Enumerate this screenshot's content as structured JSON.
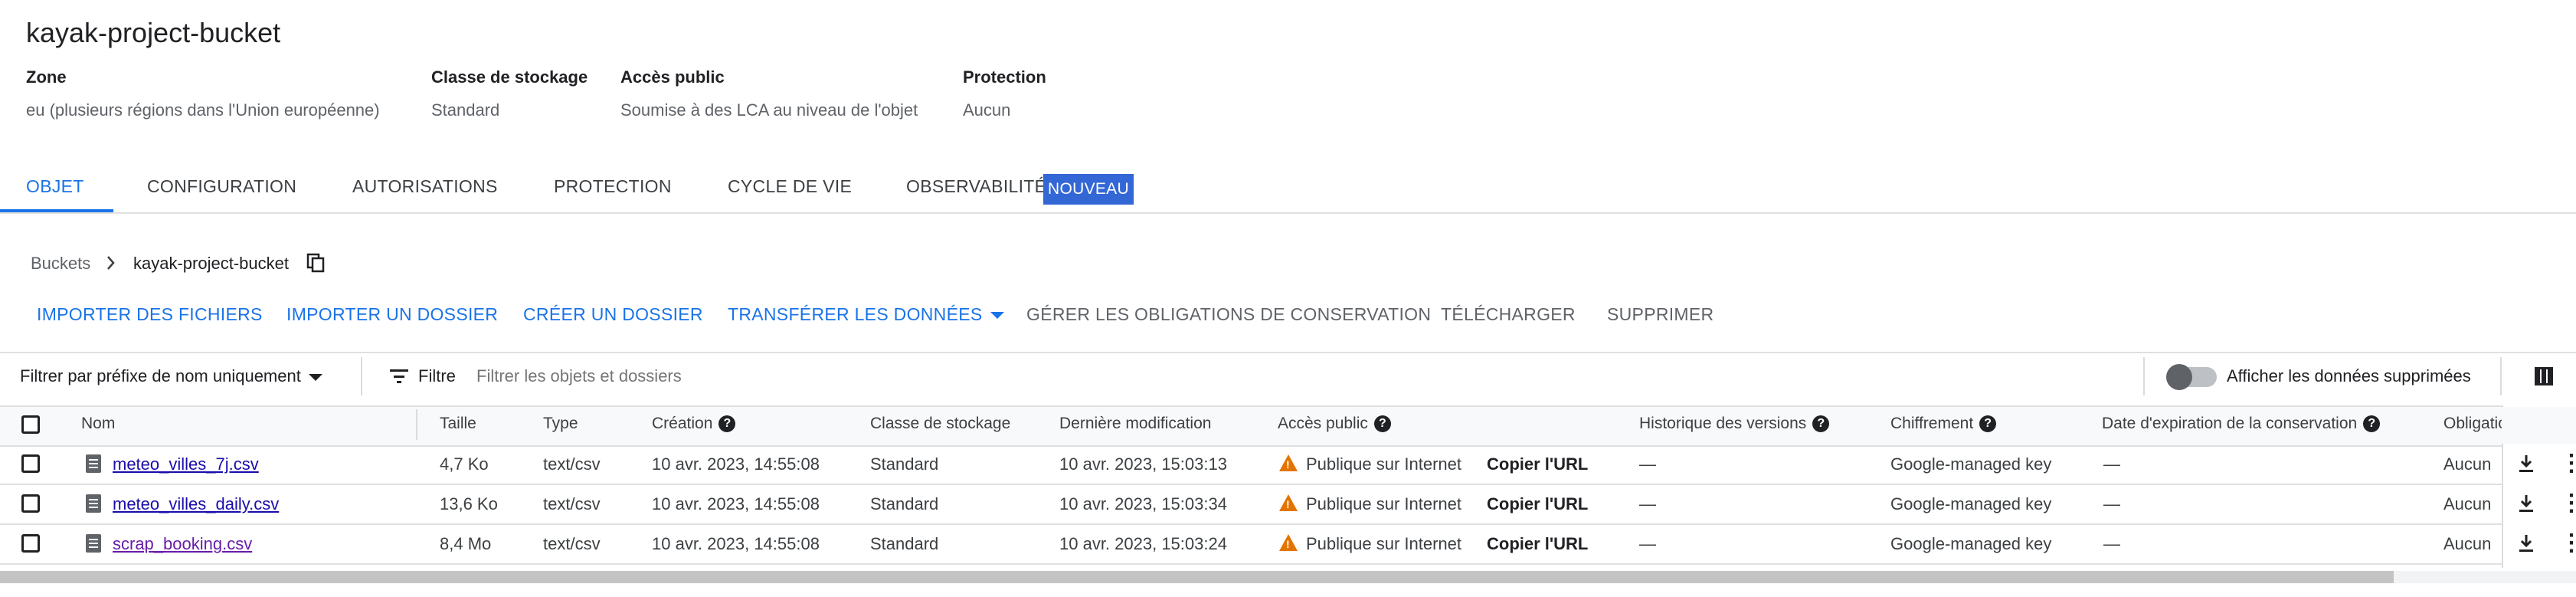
{
  "bucket": {
    "title": "kayak-project-bucket",
    "info": [
      {
        "label": "Zone",
        "value": "eu (plusieurs régions dans l'Union européenne)"
      },
      {
        "label": "Classe de stockage",
        "value": "Standard"
      },
      {
        "label": "Accès public",
        "value": "Soumise à des LCA au niveau de l'objet"
      },
      {
        "label": "Protection",
        "value": "Aucun"
      }
    ]
  },
  "tabs": [
    {
      "label": "OBJET",
      "active": true
    },
    {
      "label": "CONFIGURATION"
    },
    {
      "label": "AUTORISATIONS"
    },
    {
      "label": "PROTECTION"
    },
    {
      "label": "CYCLE DE VIE"
    },
    {
      "label": "OBSERVABILITÉ"
    }
  ],
  "tab_badge": "NOUVEAU",
  "breadcrumb": {
    "root": "Buckets",
    "current": "kayak-project-bucket"
  },
  "actions": [
    {
      "label": "IMPORTER DES FICHIERS",
      "enabled": true
    },
    {
      "label": "IMPORTER UN DOSSIER",
      "enabled": true
    },
    {
      "label": "CRÉER UN DOSSIER",
      "enabled": true
    },
    {
      "label": "TRANSFÉRER LES DONNÉES",
      "enabled": true
    },
    {
      "label": "GÉRER LES OBLIGATIONS DE CONSERVATION",
      "enabled": false
    },
    {
      "label": "TÉLÉCHARGER",
      "enabled": false
    },
    {
      "label": "SUPPRIMER",
      "enabled": false
    }
  ],
  "filter": {
    "prefix_select": "Filtrer par préfixe de nom uniquement",
    "filter_label": "Filtre",
    "placeholder": "Filtrer les objets et dossiers",
    "toggle_label": "Afficher les données supprimées",
    "toggle_on": false
  },
  "table": {
    "columns": [
      "Nom",
      "Taille",
      "Type",
      "Création",
      "Classe de stockage",
      "Dernière modification",
      "Accès public",
      "Historique des versions",
      "Chiffrement",
      "Date d'expiration de la conservation",
      "Obligatio"
    ],
    "rows": [
      {
        "name": "meteo_villes_7j.csv",
        "size": "4,7 Ko",
        "type": "text/csv",
        "created": "10 avr. 2023, 14:55:08",
        "storage": "Standard",
        "modified": "10 avr. 2023, 15:03:13",
        "access": "Publique sur Internet",
        "copy": "Copier l'URL",
        "history": "—",
        "encryption": "Google-managed key",
        "expiration": "—",
        "obligation": "Aucun"
      },
      {
        "name": "meteo_villes_daily.csv",
        "size": "13,6 Ko",
        "type": "text/csv",
        "created": "10 avr. 2023, 14:55:08",
        "storage": "Standard",
        "modified": "10 avr. 2023, 15:03:34",
        "access": "Publique sur Internet",
        "copy": "Copier l'URL",
        "history": "—",
        "encryption": "Google-managed key",
        "expiration": "—",
        "obligation": "Aucun"
      },
      {
        "name": "scrap_booking.csv",
        "size": "8,4 Mo",
        "type": "text/csv",
        "created": "10 avr. 2023, 14:55:08",
        "storage": "Standard",
        "modified": "10 avr. 2023, 15:03:24",
        "access": "Publique sur Internet",
        "copy": "Copier l'URL",
        "history": "—",
        "encryption": "Google-managed key",
        "expiration": "—",
        "obligation": "Aucun"
      }
    ]
  },
  "colors": {
    "accent": "#1a73e8",
    "badge": "#3367d6",
    "warning": "#e37400",
    "link": "#1a0dab",
    "visited_link": "#681da8"
  },
  "icons": {
    "breadcrumb_separator": "chevron-right-icon",
    "copy": "copy-icon",
    "file": "file-icon",
    "warning": "warning-icon",
    "download": "download-icon",
    "more": "more-vert-icon",
    "columns": "column-display-icon",
    "filter": "filter-icon"
  }
}
